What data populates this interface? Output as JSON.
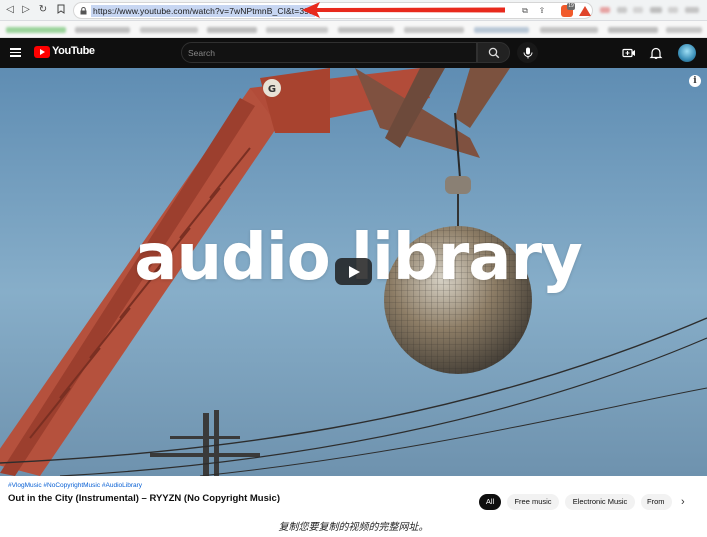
{
  "browser": {
    "url": "https://www.youtube.com/watch?v=7wNPtmnB_CI&t=39s",
    "brave_count": "19"
  },
  "youtube": {
    "logo_text": "YouTube",
    "search_placeholder": "Search"
  },
  "video": {
    "overlay_text": "audio library",
    "channel_badge": "G"
  },
  "below_video": {
    "hashtags": "#VlogMusic #NoCopyrightMusic #AudioLibrary",
    "title": "Out in the City (Instrumental) – RYYZN (No Copyright Music)"
  },
  "chips": [
    "All",
    "Free music",
    "Electronic Music",
    "From"
  ],
  "caption": "复制您要复制的视频的完整网址。",
  "colors": {
    "youtube_red": "#ff0000",
    "arrow_red": "#e8291c",
    "masthead": "#0f0f0f"
  },
  "icons": [
    "back-icon",
    "forward-icon",
    "reload-icon",
    "bookmark-icon",
    "lock-icon",
    "install-icon",
    "share-icon",
    "brave-shield-icon",
    "bat-rewards-icon",
    "menu-icon",
    "youtube-logo-icon",
    "search-icon",
    "mic-icon",
    "create-icon",
    "bell-icon",
    "avatar",
    "play-icon",
    "info-icon",
    "chevron-right-icon"
  ]
}
